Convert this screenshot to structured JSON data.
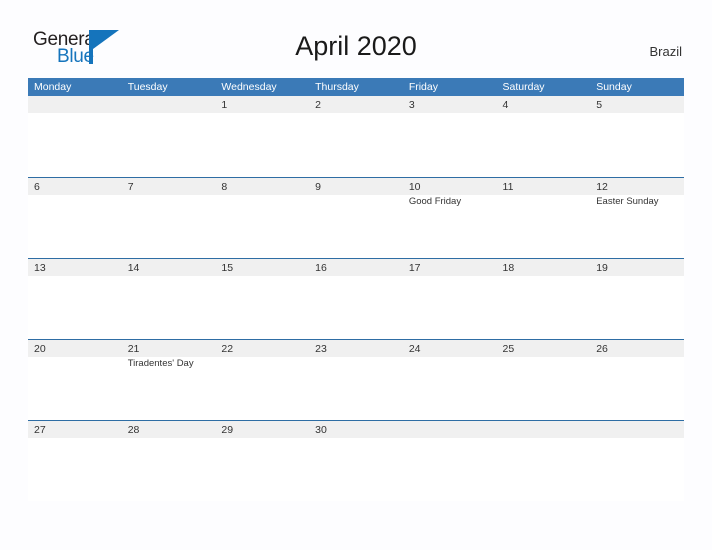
{
  "brand": {
    "name_top": "General",
    "name_bottom": "Blue",
    "mark": "triangle-logo-icon",
    "color_primary": "#1574bc",
    "color_text": "#231f20"
  },
  "header": {
    "title": "April 2020",
    "country": "Brazil"
  },
  "theme": {
    "header_bg": "#3b7ab7",
    "header_text": "#ffffff",
    "row_band_bg": "#f0f0f0",
    "row_divider": "#2e6da4",
    "page_bg": "#fdfdff",
    "text": "#333333"
  },
  "calendar": {
    "month": "April",
    "year": "2020",
    "weekday_headers": [
      "Monday",
      "Tuesday",
      "Wednesday",
      "Thursday",
      "Friday",
      "Saturday",
      "Sunday"
    ],
    "weeks": [
      [
        {
          "day": "",
          "event": ""
        },
        {
          "day": "",
          "event": ""
        },
        {
          "day": "1",
          "event": ""
        },
        {
          "day": "2",
          "event": ""
        },
        {
          "day": "3",
          "event": ""
        },
        {
          "day": "4",
          "event": ""
        },
        {
          "day": "5",
          "event": ""
        }
      ],
      [
        {
          "day": "6",
          "event": ""
        },
        {
          "day": "7",
          "event": ""
        },
        {
          "day": "8",
          "event": ""
        },
        {
          "day": "9",
          "event": ""
        },
        {
          "day": "10",
          "event": "Good Friday"
        },
        {
          "day": "11",
          "event": ""
        },
        {
          "day": "12",
          "event": "Easter Sunday"
        }
      ],
      [
        {
          "day": "13",
          "event": ""
        },
        {
          "day": "14",
          "event": ""
        },
        {
          "day": "15",
          "event": ""
        },
        {
          "day": "16",
          "event": ""
        },
        {
          "day": "17",
          "event": ""
        },
        {
          "day": "18",
          "event": ""
        },
        {
          "day": "19",
          "event": ""
        }
      ],
      [
        {
          "day": "20",
          "event": ""
        },
        {
          "day": "21",
          "event": "Tiradentes' Day"
        },
        {
          "day": "22",
          "event": ""
        },
        {
          "day": "23",
          "event": ""
        },
        {
          "day": "24",
          "event": ""
        },
        {
          "day": "25",
          "event": ""
        },
        {
          "day": "26",
          "event": ""
        }
      ],
      [
        {
          "day": "27",
          "event": ""
        },
        {
          "day": "28",
          "event": ""
        },
        {
          "day": "29",
          "event": ""
        },
        {
          "day": "30",
          "event": ""
        },
        {
          "day": "",
          "event": ""
        },
        {
          "day": "",
          "event": ""
        },
        {
          "day": "",
          "event": ""
        }
      ]
    ]
  }
}
